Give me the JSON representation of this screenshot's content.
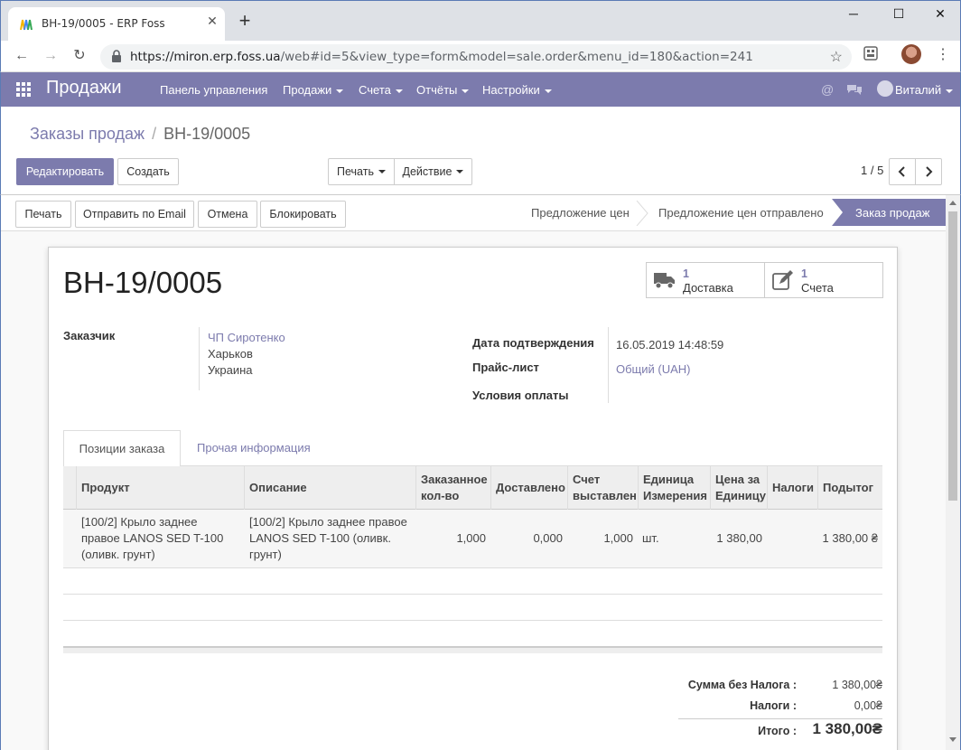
{
  "browser": {
    "tab_title": "ВН-19/0005 - ERP Foss",
    "url_host": "https://miron.erp.foss.ua",
    "url_path": "/web#id=5&view_type=form&model=sale.order&menu_id=180&action=241"
  },
  "navbar": {
    "app_name": "Продажи",
    "menu": [
      "Панель управления",
      "Продажи",
      "Счета",
      "Отчёты",
      "Настройки"
    ],
    "user": "Виталий"
  },
  "control_panel": {
    "breadcrumb_parent": "Заказы продаж",
    "breadcrumb_current": "ВН-19/0005",
    "edit_label": "Редактировать",
    "create_label": "Создать",
    "print_label": "Печать",
    "action_label": "Действие",
    "pager": "1 / 5"
  },
  "statusbar": {
    "buttons": [
      "Печать",
      "Отправить по Email",
      "Отмена",
      "Блокировать"
    ],
    "stages": [
      "Предложение цен",
      "Предложение цен отправлено",
      "Заказ продаж"
    ]
  },
  "form": {
    "title": "ВН-19/0005",
    "stat_delivery": {
      "count": "1",
      "label": "Доставка"
    },
    "stat_invoice": {
      "count": "1",
      "label": "Счета"
    },
    "customer_label": "Заказчик",
    "customer_name": "ЧП Сиротенко",
    "customer_city": "Харьков",
    "customer_country": "Украина",
    "confirm_date_label": "Дата подтверждения",
    "confirm_date": "16.05.2019 14:48:59",
    "pricelist_label": "Прайс-лист",
    "pricelist": "Общий (UAH)",
    "payment_terms_label": "Условия оплаты"
  },
  "tabs": {
    "active": "Позиции заказа",
    "other": "Прочая информация"
  },
  "table": {
    "headers": {
      "product": "Продукт",
      "description": "Описание",
      "qty_1": "Заказанное",
      "qty_2": "кол-во",
      "delivered": "Доставлено",
      "invoiced_1": "Счет",
      "invoiced_2": "выставлен",
      "uom_1": "Единица",
      "uom_2": "Измерения",
      "price_1": "Цена за",
      "price_2": "Единицу",
      "taxes": "Налоги",
      "subtotal": "Подытог"
    },
    "row": {
      "product_1": "[100/2] Крыло заднее",
      "product_2": "правое LANOS SED T-100",
      "product_3": "(оливк. грунт)",
      "desc_1": "[100/2] Крыло заднее правое",
      "desc_2": "LANOS SED T-100 (оливк.",
      "desc_3": "грунт)",
      "qty": "1,000",
      "delivered": "0,000",
      "invoiced": "1,000",
      "uom": "шт.",
      "price": "1 380,00",
      "subtotal": "1 380,00 ₴"
    }
  },
  "totals": {
    "untaxed_label": "Сумма без Налога :",
    "untaxed": "1 380,00₴",
    "taxes_label": "Налоги :",
    "taxes": "0,00₴",
    "total_label": "Итого :",
    "total": "1 380,00₴"
  }
}
